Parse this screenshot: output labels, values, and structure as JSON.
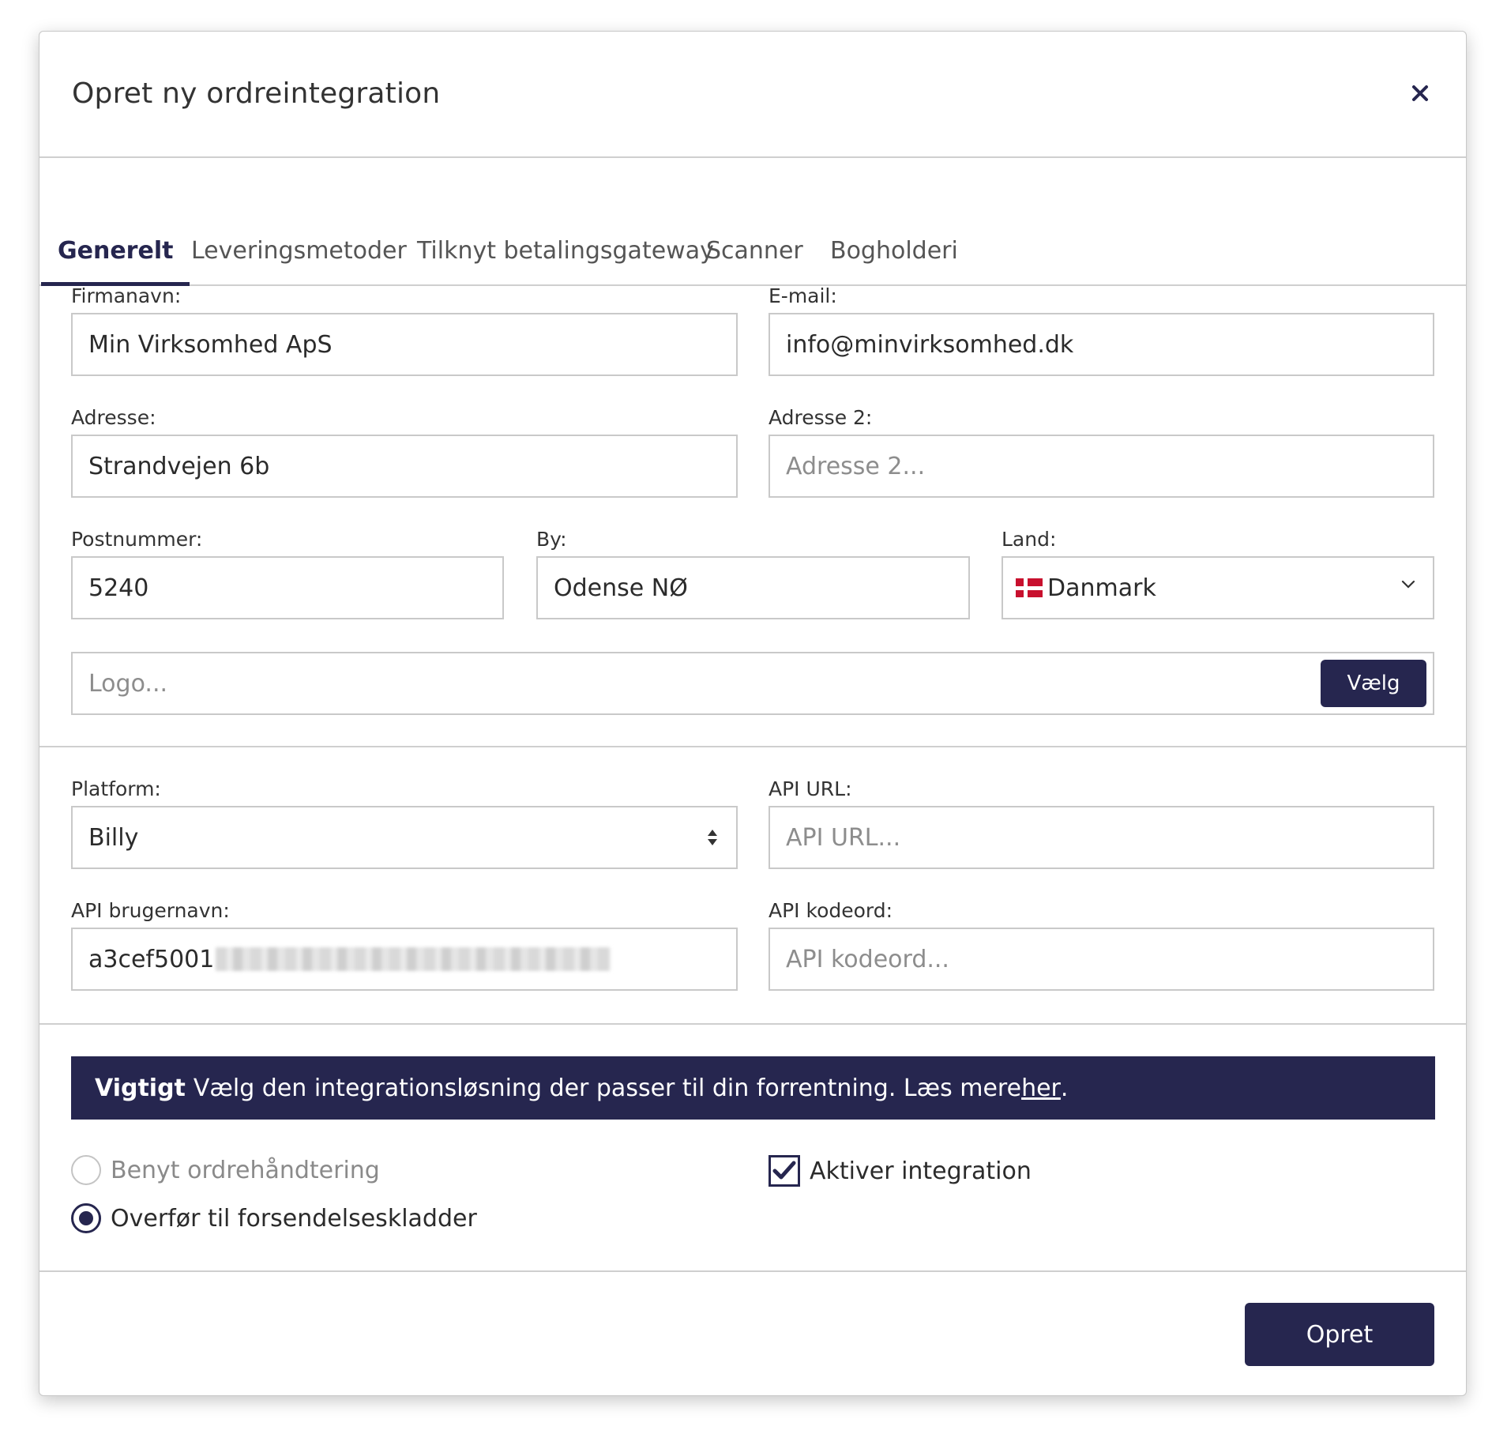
{
  "dialog": {
    "title": "Opret ny ordreintegration",
    "close_icon": "close-icon"
  },
  "tabs": [
    {
      "label": "Generelt",
      "active": true
    },
    {
      "label": "Leveringsmetoder",
      "active": false
    },
    {
      "label": "Tilknyt betalingsgateway",
      "active": false
    },
    {
      "label": "Scanner",
      "active": false
    },
    {
      "label": "Bogholderi",
      "active": false
    }
  ],
  "general": {
    "company_name": {
      "label": "Firmanavn:",
      "value": "Min Virksomhed ApS"
    },
    "email": {
      "label": "E-mail:",
      "value": "info@minvirksomhed.dk"
    },
    "address": {
      "label": "Adresse:",
      "value": "Strandvejen 6b"
    },
    "address2": {
      "label": "Adresse 2:",
      "placeholder": "Adresse 2..."
    },
    "postal_code": {
      "label": "Postnummer:",
      "value": "5240"
    },
    "city": {
      "label": "By:",
      "value": "Odense NØ"
    },
    "country": {
      "label": "Land:",
      "value": "Danmark",
      "flag": "denmark-flag-icon"
    },
    "logo": {
      "placeholder": "Logo...",
      "button": "Vælg"
    }
  },
  "api": {
    "platform": {
      "label": "Platform:",
      "value": "Billy"
    },
    "api_url": {
      "label": "API URL:",
      "placeholder": "API URL..."
    },
    "api_username": {
      "label": "API brugernavn:",
      "value": "a3cef5001"
    },
    "api_password": {
      "label": "API kodeord:",
      "placeholder": "API kodeord..."
    }
  },
  "notice": {
    "bold": "Vigtigt",
    "text": "Vælg den integrationsløsning der passer til din forrentning. Læs mere ",
    "link": "her",
    "end": "."
  },
  "options": {
    "radio_order_handling": {
      "label": "Benyt ordrehåndtering",
      "selected": false
    },
    "radio_transfer": {
      "label": "Overfør til forsendelseskladder",
      "selected": true
    },
    "checkbox_activate": {
      "label": "Aktiver integration",
      "checked": true
    }
  },
  "footer": {
    "create_button": "Opret"
  },
  "colors": {
    "brand": "#26264f",
    "border": "#c9c9c9",
    "placeholder": "#8d8d8d"
  }
}
